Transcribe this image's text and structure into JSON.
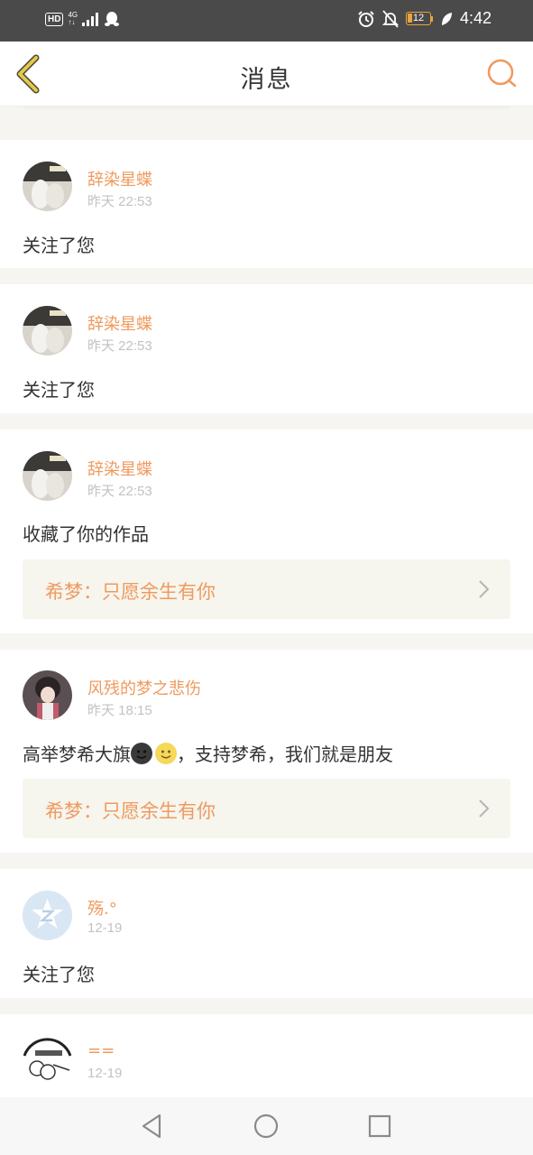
{
  "status_bar": {
    "hd": "HD",
    "network": "4G",
    "network_sub": "↑↓",
    "battery": "12",
    "time": "4:42"
  },
  "header": {
    "title": "消息"
  },
  "messages": [
    {
      "username": "辞染星蝶",
      "time": "昨天 22:53",
      "text": "关注了您"
    },
    {
      "username": "辞染星蝶",
      "time": "昨天 22:53",
      "text": "关注了您"
    },
    {
      "username": "辞染星蝶",
      "time": "昨天 22:53",
      "text": "收藏了你的作品",
      "work": "希梦：只愿余生有你"
    },
    {
      "username": "风残的梦之悲伤",
      "time": "昨天 18:15",
      "text_before": "高举梦希大旗",
      "text_after": "，支持梦希，我们就是朋友",
      "work": "希梦：只愿余生有你"
    },
    {
      "username": "殇.°",
      "time": "12-19",
      "text": "关注了您"
    },
    {
      "username": "==",
      "time": "12-19"
    }
  ],
  "colors": {
    "accent": "#ef9a5e",
    "title_text": "#333333",
    "back_arrow": "#e6c84a",
    "status_bar": "#4a4a4a"
  },
  "icons": {
    "back": "back-arrow-icon",
    "search": "search-icon",
    "nav_back": "triangle-back-icon",
    "nav_home": "circle-home-icon",
    "nav_recent": "square-recent-icon"
  }
}
